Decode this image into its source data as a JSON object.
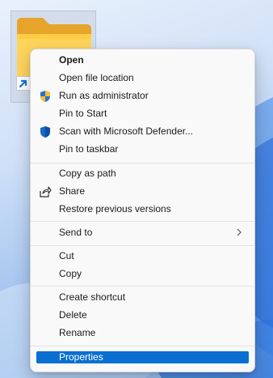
{
  "desktop": {
    "shortcut_icon": "folder-shortcut-icon"
  },
  "context_menu": {
    "groups": [
      [
        {
          "label": "Open",
          "bold": true,
          "icon": null
        },
        {
          "label": "Open file location",
          "icon": null
        },
        {
          "label": "Run as administrator",
          "icon": "uac-shield-icon"
        },
        {
          "label": "Pin to Start",
          "icon": null
        },
        {
          "label": "Scan with Microsoft Defender...",
          "icon": "defender-shield-icon"
        },
        {
          "label": "Pin to taskbar",
          "icon": null
        }
      ],
      [
        {
          "label": "Copy as path",
          "icon": null
        },
        {
          "label": "Share",
          "icon": "share-icon"
        },
        {
          "label": "Restore previous versions",
          "icon": null
        }
      ],
      [
        {
          "label": "Send to",
          "icon": null,
          "submenu": true
        }
      ],
      [
        {
          "label": "Cut",
          "icon": null
        },
        {
          "label": "Copy",
          "icon": null
        }
      ],
      [
        {
          "label": "Create shortcut",
          "icon": null
        },
        {
          "label": "Delete",
          "icon": null
        },
        {
          "label": "Rename",
          "icon": null
        }
      ],
      [
        {
          "label": "Properties",
          "icon": null,
          "selected": true
        }
      ]
    ],
    "accent_color": "#0a6fd1"
  }
}
